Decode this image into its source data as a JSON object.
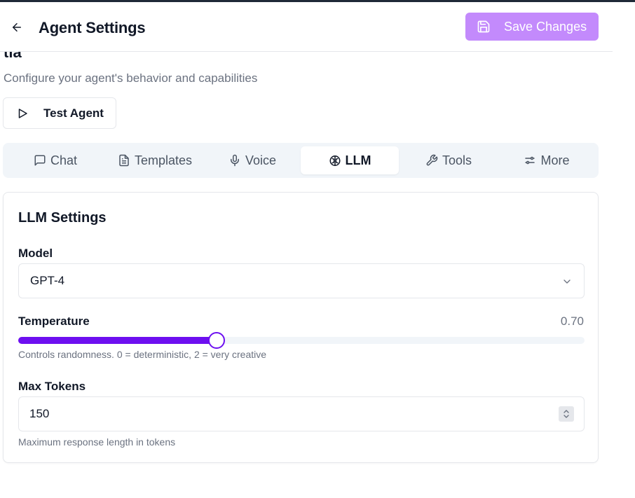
{
  "header": {
    "title": "Agent Settings",
    "save_label": "Save Changes",
    "back_icon": "arrow-left-icon",
    "save_icon": "save-icon",
    "save_color": "#c084fc"
  },
  "peek_text": "tia",
  "subtitle": "Configure your agent's behavior and capabilities",
  "test_button": {
    "label": "Test Agent",
    "icon": "play-icon"
  },
  "tabs": [
    {
      "label": "Chat",
      "icon": "chat-icon",
      "active": false
    },
    {
      "label": "Templates",
      "icon": "file-text-icon",
      "active": false
    },
    {
      "label": "Voice",
      "icon": "mic-icon",
      "active": false
    },
    {
      "label": "LLM",
      "icon": "brain-icon",
      "active": true
    },
    {
      "label": "Tools",
      "icon": "wrench-icon",
      "active": false
    },
    {
      "label": "More",
      "icon": "sliders-icon",
      "active": false
    }
  ],
  "llm": {
    "title": "LLM Settings",
    "model": {
      "label": "Model",
      "value": "GPT-4"
    },
    "temperature": {
      "label": "Temperature",
      "value_text": "0.70",
      "value": 0.7,
      "min": 0,
      "max": 2,
      "help": "Controls randomness. 0 = deterministic, 2 = very creative",
      "accent": "#6d0ff0"
    },
    "max_tokens": {
      "label": "Max Tokens",
      "value": "150",
      "help": "Maximum response length in tokens"
    }
  }
}
